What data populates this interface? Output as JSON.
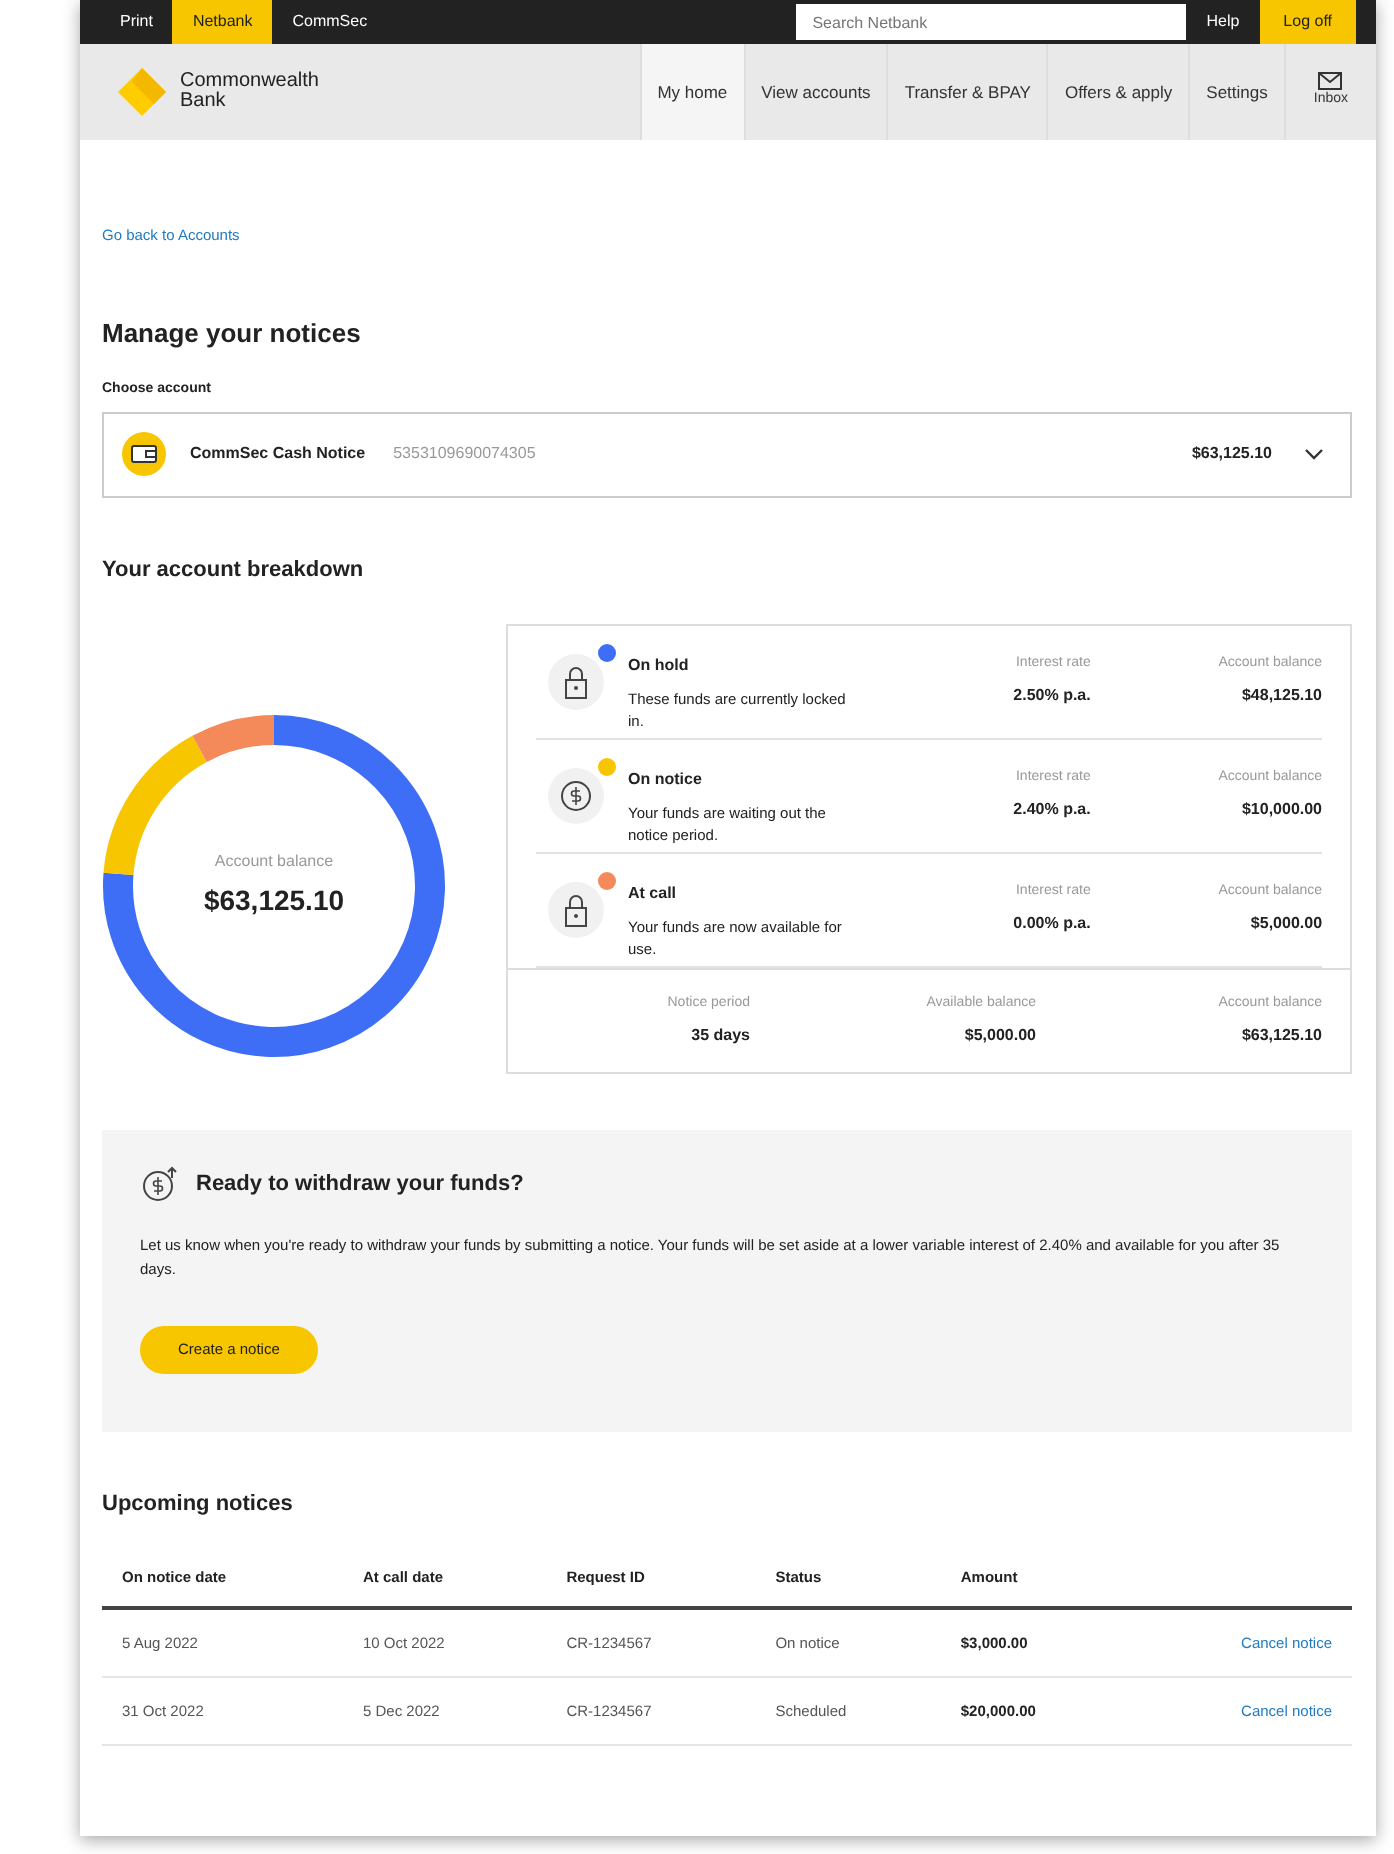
{
  "top_bar": {
    "links": [
      {
        "label": "Print",
        "selected": false
      },
      {
        "label": "Netbank",
        "selected": true
      },
      {
        "label": "CommSec",
        "selected": false
      }
    ],
    "search": {
      "placeholder": "Search Netbank"
    },
    "help": "Help",
    "logoff": "Log off"
  },
  "nav": {
    "brand": "Commonwealth Bank",
    "tabs": [
      {
        "label": "My home",
        "selected": true
      },
      {
        "label": "View accounts",
        "selected": false
      },
      {
        "label": "Transfer & BPAY",
        "selected": false
      },
      {
        "label": "Offers & apply",
        "selected": false
      },
      {
        "label": "Settings",
        "selected": false
      }
    ],
    "inbox": "Inbox"
  },
  "back_link": "Go back to Accounts",
  "title": "Manage your notices",
  "account": {
    "label": "Choose account",
    "name": "CommSec Cash Notice",
    "number": "5353109690074305",
    "balance": "$63,125.10"
  },
  "breakdown": {
    "title": "Your account breakdown",
    "center_label": "Account balance",
    "center_value": "$63,125.10",
    "items": [
      {
        "kind": "lock",
        "name": "On hold",
        "desc": "These funds are currently locked in.",
        "rate_label": "Interest rate",
        "rate": "2.50% p.a.",
        "balance_label": "Account balance",
        "balance": "$48,125.10",
        "color": "#3d6ef5"
      },
      {
        "kind": "dollar",
        "name": "On notice",
        "desc": "Your funds are waiting out the notice period.",
        "rate_label": "Interest rate",
        "rate": "2.40% p.a.",
        "balance_label": "Account balance",
        "balance": "$10,000.00",
        "color": "#f7c600"
      },
      {
        "kind": "lock",
        "name": "At call",
        "desc": "Your funds are now available for use.",
        "rate_label": "Interest rate",
        "rate": "0.00% p.a.",
        "balance_label": "Account balance",
        "balance": "$5,000.00",
        "color": "#f4895a"
      }
    ],
    "summary": [
      {
        "label": "Notice period",
        "value": "35 days"
      },
      {
        "label": "Available balance",
        "value": "$5,000.00"
      },
      {
        "label": "Account balance",
        "value": "$63,125.10"
      }
    ]
  },
  "withdraw": {
    "title": "Ready to withdraw your funds?",
    "text": "Let us know when you're ready to withdraw your funds by submitting a notice. Your funds will be set aside at a lower variable interest of 2.40% and available for you after 35 days.",
    "button": "Create a notice"
  },
  "upcoming": {
    "title": "Upcoming notices",
    "columns": [
      "On notice date",
      "At call date",
      "Request ID",
      "Status",
      "Amount"
    ],
    "rows": [
      {
        "cells": [
          "5 Aug 2022",
          "10 Oct 2022",
          "CR-1234567",
          "On notice",
          "$3,000.00"
        ],
        "action": "Cancel notice"
      },
      {
        "cells": [
          "31 Oct 2022",
          "5 Dec 2022",
          "CR-1234567",
          "Scheduled",
          "$20,000.00"
        ],
        "action": "Cancel notice"
      }
    ]
  }
}
